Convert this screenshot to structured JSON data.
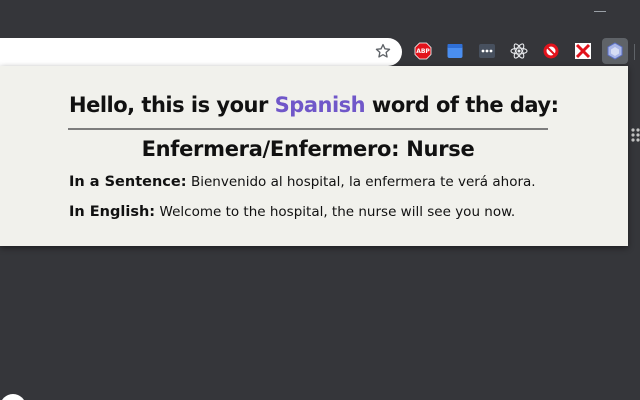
{
  "popup": {
    "heading_pre": "Hello, this is your",
    "heading_accent": "Spanish",
    "heading_post": "word of the day:",
    "word": "Enfermera/Enfermero: Nurse",
    "sentence_label": "In a Sentence:",
    "sentence_text": "Bienvenido al hospital, la enfermera te verá ahora.",
    "english_label": "In English:",
    "english_text": "Welcome to the hospital, the nurse will see you now.",
    "accent_color": "#7057c9"
  },
  "extensions": {
    "abp_label": "ABP"
  },
  "icons": [
    "star-icon",
    "adblock-plus-icon",
    "blue-window-icon",
    "dots-icon",
    "react-icon",
    "blocked-icon",
    "red-x-icon",
    "word-of-day-icon"
  ]
}
